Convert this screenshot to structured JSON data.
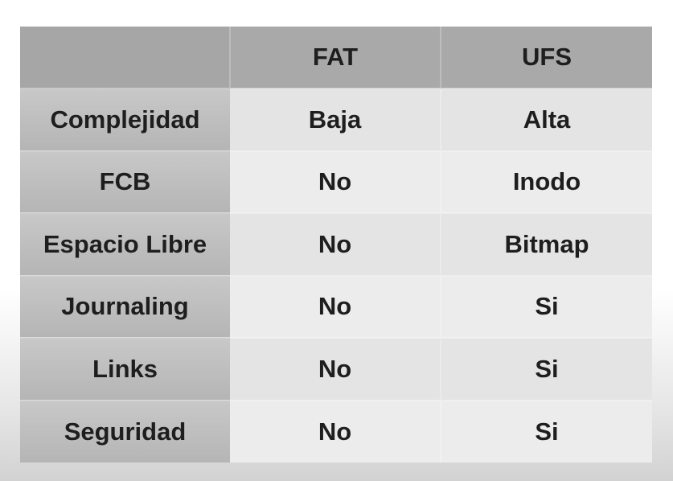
{
  "table": {
    "headers": [
      "",
      "FAT",
      "UFS"
    ],
    "rows": [
      {
        "label": "Complejidad",
        "fat": "Baja",
        "ufs": "Alta"
      },
      {
        "label": "FCB",
        "fat": "No",
        "ufs": "Inodo"
      },
      {
        "label": "Espacio Libre",
        "fat": "No",
        "ufs": "Bitmap"
      },
      {
        "label": "Journaling",
        "fat": "No",
        "ufs": "Si"
      },
      {
        "label": "Links",
        "fat": "No",
        "ufs": "Si"
      },
      {
        "label": "Seguridad",
        "fat": "No",
        "ufs": "Si"
      }
    ]
  },
  "colors": {
    "header_bg": "#a9a9a9",
    "label_bg": "#bdbdbd",
    "cell_bg": "#e8e8e8",
    "text": "#1e1e1e"
  }
}
